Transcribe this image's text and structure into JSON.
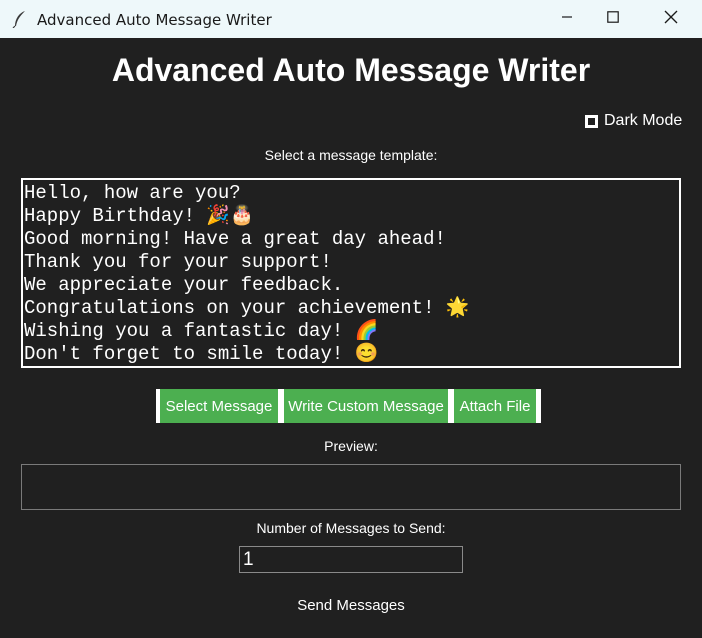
{
  "window": {
    "title": "Advanced Auto Message Writer",
    "icon": "feather-icon",
    "controls": [
      "minimize-icon",
      "maximize-icon",
      "close-icon"
    ]
  },
  "main": {
    "heading": "Advanced Auto Message Writer",
    "dark_mode_label": "Dark Mode",
    "template_label": "Select a message template:",
    "templates": [
      "Hello, how are you?",
      "Happy Birthday! 🎉🎂",
      "Good morning! Have a great day ahead!",
      "Thank you for your support!",
      "We appreciate your feedback.",
      "Congratulations on your achievement! 🌟",
      "Wishing you a fantastic day! 🌈",
      "Don't forget to smile today! 😊"
    ],
    "buttons": {
      "select": "Select Message",
      "custom": "Write Custom Message",
      "attach": "Attach File"
    },
    "preview_label": "Preview:",
    "preview_text": "",
    "count_label": "Number of Messages to Send:",
    "count_value": "1",
    "send_label": "Send Messages"
  },
  "colors": {
    "background": "#202020",
    "button": "#4caf50",
    "titlebar": "#eef8fa"
  }
}
